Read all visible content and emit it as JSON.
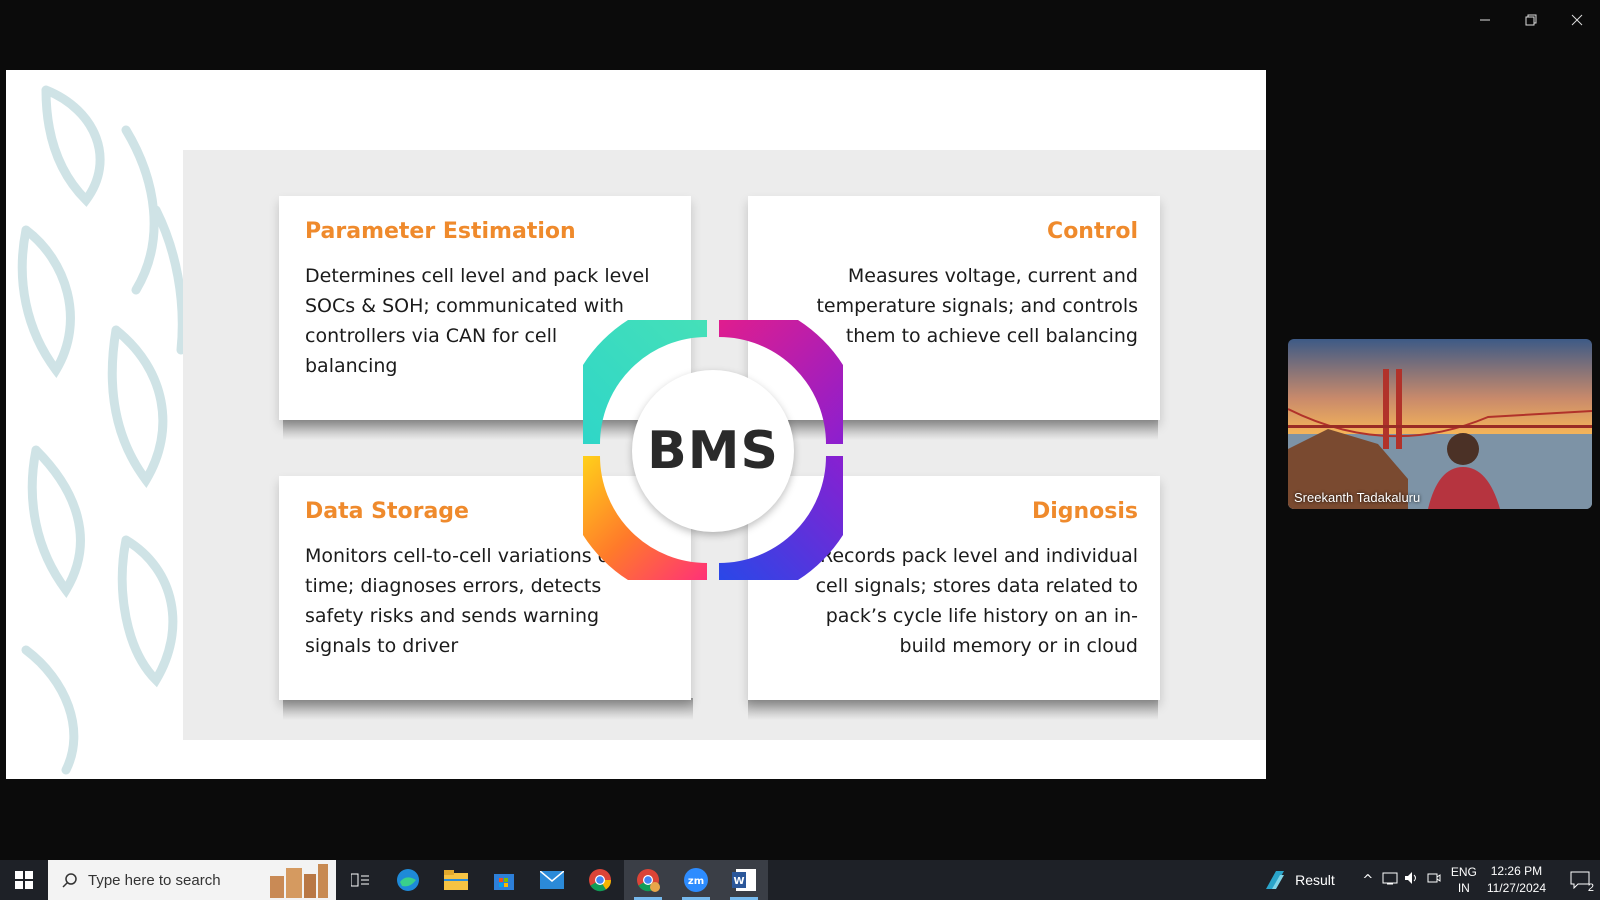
{
  "window": {
    "minimize_icon": "minimize-icon",
    "restore_icon": "restore-icon",
    "close_icon": "close-icon"
  },
  "slide": {
    "center_label": "BMS",
    "cards": [
      {
        "title": "Parameter Estimation",
        "body": "Determines cell level and pack level SOCs & SOH; communicated with controllers via CAN for cell balancing"
      },
      {
        "title": "Control",
        "body": "Measures voltage, current and temperature signals; and controls them to achieve cell balancing"
      },
      {
        "title": "Data Storage",
        "body": "Monitors cell-to-cell variations over time; diagnoses errors, detects safety risks and sends warning signals to driver"
      },
      {
        "title": "Dignosis",
        "body": "Records pack level and individual cell signals; stores data related to pack’s cycle life history on an in-build memory or in cloud"
      }
    ],
    "accent_color": "#ef8a2c"
  },
  "video": {
    "participant_name": "Sreekanth Tadakaluru"
  },
  "taskbar": {
    "search_placeholder": "Type here to search",
    "weather_label": "Result",
    "lang_top": "ENG",
    "lang_bottom": "IN",
    "time": "12:26 PM",
    "date": "11/27/2024",
    "notification_count": "2"
  }
}
